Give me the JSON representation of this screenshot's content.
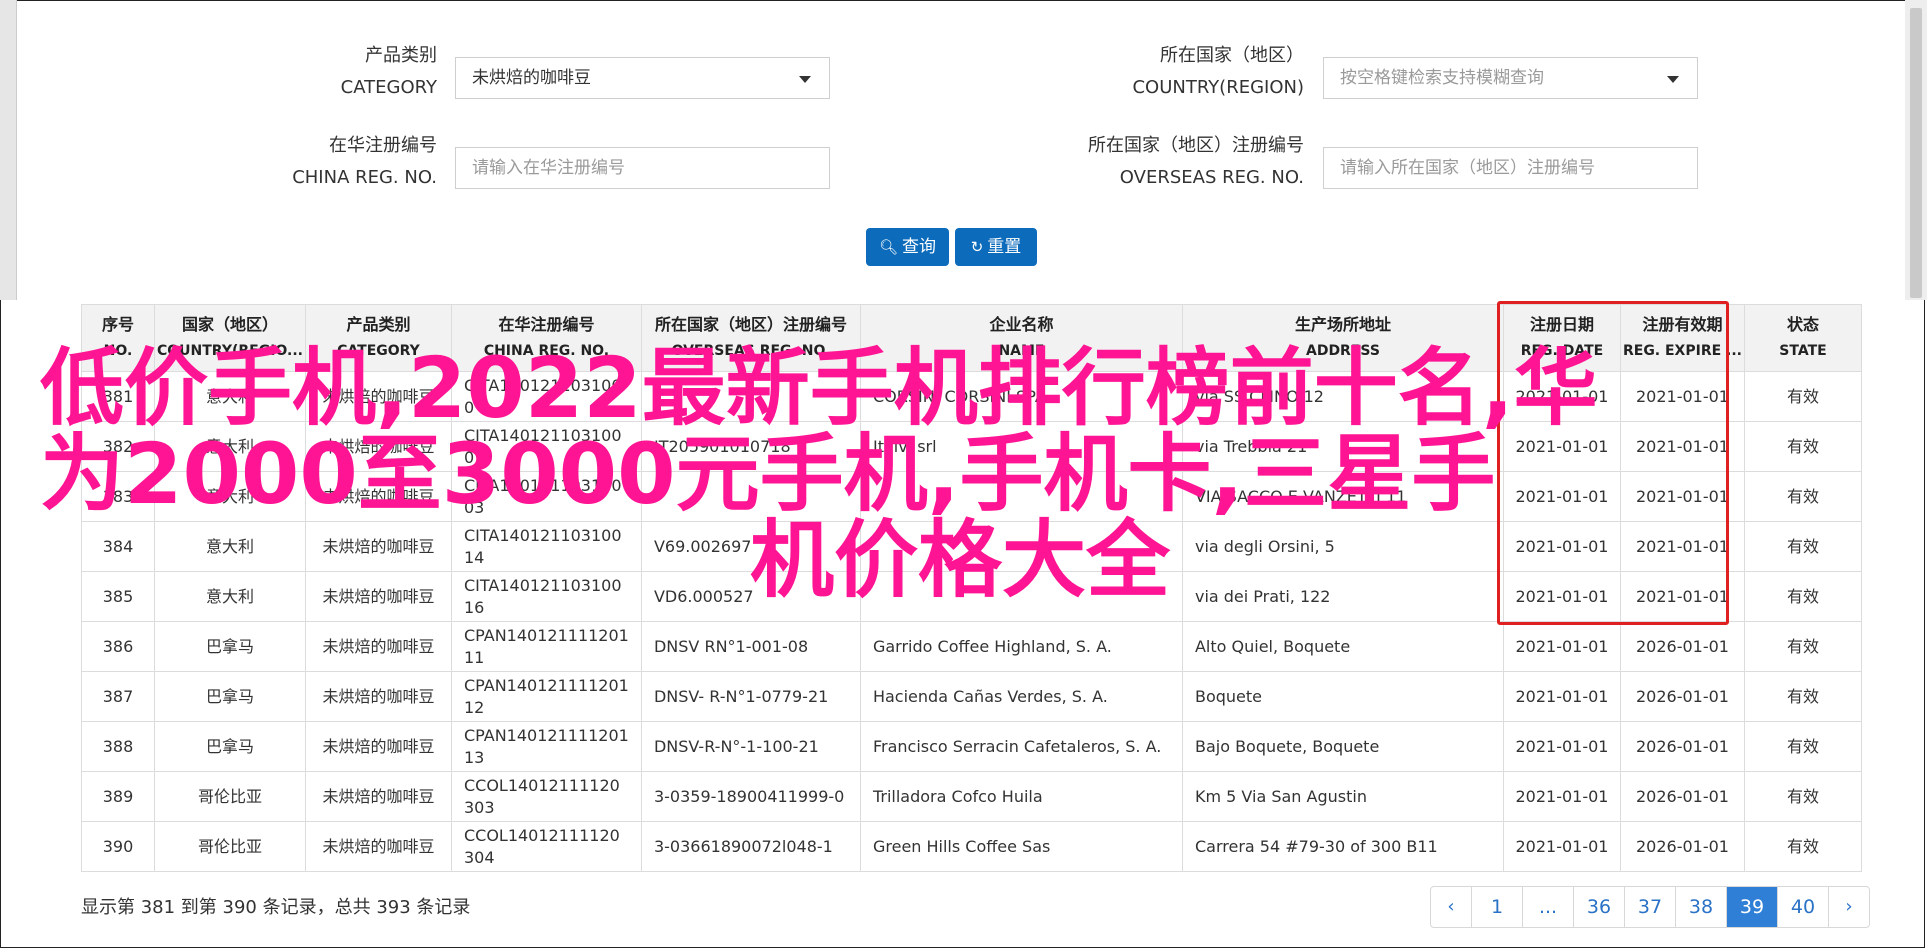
{
  "filters": {
    "category": {
      "label_cn": "产品类别",
      "label_en": "CATEGORY",
      "value": "未烘焙的咖啡豆"
    },
    "country": {
      "label_cn": "所在国家（地区）",
      "label_en": "COUNTRY(REGION)",
      "placeholder": "按空格键检索支持模糊查询"
    },
    "china_reg": {
      "label_cn": "在华注册编号",
      "label_en": "CHINA REG. NO.",
      "placeholder": "请输入在华注册编号"
    },
    "overseas_reg": {
      "label_cn": "所在国家（地区）注册编号",
      "label_en": "OVERSEAS REG. NO.",
      "placeholder": "请输入所在国家（地区）注册编号"
    }
  },
  "buttons": {
    "search": "查询",
    "reset": "重置"
  },
  "table": {
    "headers": [
      {
        "cn": "序号",
        "en": "NO."
      },
      {
        "cn": "国家（地区）",
        "en": "COUNTRY(REGIO..."
      },
      {
        "cn": "产品类别",
        "en": "CATEGORY"
      },
      {
        "cn": "在华注册编号",
        "en": "CHINA REG. NO."
      },
      {
        "cn": "所在国家（地区）注册编号",
        "en": "OVERSEAS REG. NO."
      },
      {
        "cn": "企业名称",
        "en": "NAME"
      },
      {
        "cn": "生产场所地址",
        "en": "ADDRESS"
      },
      {
        "cn": "注册日期",
        "en": "REG. DATE"
      },
      {
        "cn": "注册有效期",
        "en": "REG. EXPIRE ..."
      },
      {
        "cn": "状态",
        "en": "STATE"
      }
    ],
    "rows": [
      [
        "381",
        "意大利",
        "未烘焙的咖啡豆",
        "CITA1401211031000\n1",
        "",
        "CORSINI CORSINI SPA",
        "via SS CLINO 12",
        "2021-01-01",
        "2021-01-01",
        "有效"
      ],
      [
        "382",
        "意大利",
        "未烘焙的咖啡豆",
        "CITA14012110310001",
        "IT205901010718",
        "Italvi srl",
        "via Trebbia 21",
        "2021-01-01",
        "2021-01-01",
        "有效"
      ],
      [
        "383",
        "意大利",
        "未烘焙的咖啡豆",
        "CITA14012110310003",
        "",
        "",
        "VIA SACCO E VANZETTI 11",
        "2021-01-01",
        "2021-01-01",
        "有效"
      ],
      [
        "384",
        "意大利",
        "未烘焙的咖啡豆",
        "CITA14012110310014",
        "V69.002697",
        "",
        "via degli Orsini, 5",
        "2021-01-01",
        "2021-01-01",
        "有效"
      ],
      [
        "385",
        "意大利",
        "未烘焙的咖啡豆",
        "CITA14012110310016",
        "VD6.000527",
        "",
        "via dei Prati, 122",
        "2021-01-01",
        "2021-01-01",
        "有效"
      ],
      [
        "386",
        "巴拿马",
        "未烘焙的咖啡豆",
        "CPAN14012111120111",
        "DNSV RN°1-001-08",
        "Garrido Coffee Highland, S. A.",
        "Alto Quiel, Boquete",
        "2021-01-01",
        "2026-01-01",
        "有效"
      ],
      [
        "387",
        "巴拿马",
        "未烘焙的咖啡豆",
        "CPAN14012111120112",
        "DNSV- R-N°1-0779-21",
        "Hacienda Cañas Verdes, S. A.",
        "Boquete",
        "2021-01-01",
        "2026-01-01",
        "有效"
      ],
      [
        "388",
        "巴拿马",
        "未烘焙的咖啡豆",
        "CPAN14012111120113",
        "DNSV-R-N°-1-100-21",
        "Francisco Serracin Cafetaleros, S. A.",
        "Bajo Boquete, Boquete",
        "2021-01-01",
        "2026-01-01",
        "有效"
      ],
      [
        "389",
        "哥伦比亚",
        "未烘焙的咖啡豆",
        "CCOL14012111120303",
        "3-0359-18900411999-0",
        "Trilladora Cofco Huila",
        "Km 5 Via San Agustin",
        "2021-01-01",
        "2026-01-01",
        "有效"
      ],
      [
        "390",
        "哥伦比亚",
        "未烘焙的咖啡豆",
        "CCOL14012111120304",
        "3-03661890072l048-1",
        "Green Hills Coffee Sas",
        "Carrera 54 #79-30 of 300 B11",
        "2021-01-01",
        "2026-01-01",
        "有效"
      ]
    ]
  },
  "overlay": {
    "line1": "低价手机,2022最新手机排行榜前十名,华",
    "line2": "为2000至3000元手机,手机卡,三星手",
    "line3": "机价格大全"
  },
  "summary": "显示第 381 到第 390 条记录，总共 393 条记录",
  "pagination": {
    "prev": "‹",
    "pages": [
      "1",
      "...",
      "36",
      "37",
      "38",
      "39",
      "40"
    ],
    "active": "39",
    "next": "›"
  },
  "colors": {
    "primary": "#0c6bbb",
    "overlay": "#ff1493",
    "highlight_box": "#e02020",
    "active_page": "#2f7fd6"
  }
}
